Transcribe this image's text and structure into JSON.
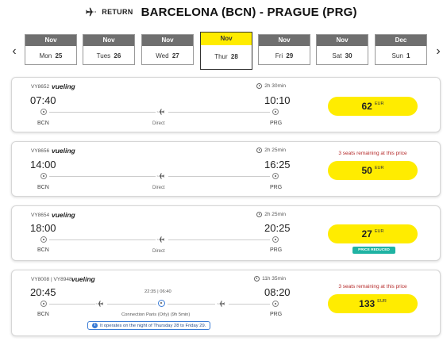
{
  "header": {
    "return_label": "RETURN",
    "route": "BARCELONA (BCN) - PRAGUE (PRG)"
  },
  "dates": [
    {
      "month": "Nov",
      "weekday": "Mon",
      "day": "25",
      "selected": false
    },
    {
      "month": "Nov",
      "weekday": "Tues",
      "day": "26",
      "selected": false
    },
    {
      "month": "Nov",
      "weekday": "Wed",
      "day": "27",
      "selected": false
    },
    {
      "month": "Nov",
      "weekday": "Thur",
      "day": "28",
      "selected": true
    },
    {
      "month": "Nov",
      "weekday": "Fri",
      "day": "29",
      "selected": false
    },
    {
      "month": "Nov",
      "weekday": "Sat",
      "day": "30",
      "selected": false
    },
    {
      "month": "Dec",
      "weekday": "Sun",
      "day": "1",
      "selected": false
    }
  ],
  "nav": {
    "prev": "‹",
    "next": "›"
  },
  "flights": [
    {
      "flight_no": "VY8652",
      "airline": "vueling",
      "duration": "2h 30min",
      "dep_time": "07:40",
      "arr_time": "10:10",
      "from": "BCN",
      "to": "PRG",
      "stop_label": "Direct",
      "price": "62",
      "currency": "EUR",
      "seats_note": "",
      "badge": ""
    },
    {
      "flight_no": "VY8656",
      "airline": "vueling",
      "duration": "2h 25min",
      "dep_time": "14:00",
      "arr_time": "16:25",
      "from": "BCN",
      "to": "PRG",
      "stop_label": "Direct",
      "price": "50",
      "currency": "EUR",
      "seats_note": "3 seats remaining at this price",
      "badge": ""
    },
    {
      "flight_no": "VY8654",
      "airline": "vueling",
      "duration": "2h 25min",
      "dep_time": "18:00",
      "arr_time": "20:25",
      "from": "BCN",
      "to": "PRG",
      "stop_label": "Direct",
      "price": "27",
      "currency": "EUR",
      "seats_note": "",
      "badge": "PRICE REDUCED"
    },
    {
      "flight_no": "VY8008",
      "flight_no_2": "VY8948",
      "airline": "vueling",
      "duration": "11h 35min",
      "dep_time": "20:45",
      "arr_time": "08:20",
      "from": "BCN",
      "to": "PRG",
      "connection_time": "22:35 | 06:40",
      "stop_label": "Connection Paris (Orly) (9h 5min)",
      "info": "It operates on the night of Thursday 28 to Friday 29.",
      "price": "133",
      "currency": "EUR",
      "seats_note": "3 seats remaining at this price",
      "badge": ""
    }
  ],
  "colors": {
    "accent": "#ffec00",
    "badge": "#1fb3a3",
    "alert": "#b52a2a",
    "info": "#3a7bd5"
  }
}
